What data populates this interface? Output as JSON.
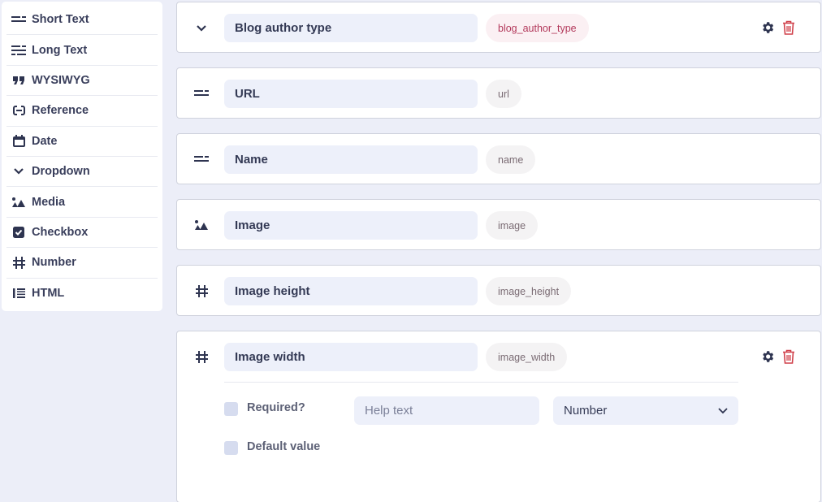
{
  "sidebar": {
    "items": [
      {
        "label": "Short Text",
        "icon": "short-text-icon"
      },
      {
        "label": "Long Text",
        "icon": "long-text-icon"
      },
      {
        "label": "WYSIWYG",
        "icon": "quote-icon"
      },
      {
        "label": "Reference",
        "icon": "link-icon"
      },
      {
        "label": "Date",
        "icon": "calendar-icon"
      },
      {
        "label": "Dropdown",
        "icon": "chevron-down-icon"
      },
      {
        "label": "Media",
        "icon": "image-icon"
      },
      {
        "label": "Checkbox",
        "icon": "checkbox-icon"
      },
      {
        "label": "Number",
        "icon": "hash-icon"
      },
      {
        "label": "HTML",
        "icon": "list-icon"
      }
    ]
  },
  "fields": [
    {
      "name": "Blog author type",
      "key": "blog_author_type",
      "icon": "chevron-down-icon",
      "key_highlight": true,
      "actions": true
    },
    {
      "name": "URL",
      "key": "url",
      "icon": "short-text-icon"
    },
    {
      "name": "Name",
      "key": "name",
      "icon": "short-text-icon"
    },
    {
      "name": "Image",
      "key": "image",
      "icon": "image-icon"
    },
    {
      "name": "Image height",
      "key": "image_height",
      "icon": "hash-icon"
    },
    {
      "name": "Image width",
      "key": "image_width",
      "icon": "hash-icon",
      "actions": true,
      "expanded": true
    }
  ],
  "expanded_options": {
    "required_label": "Required?",
    "required_checked": false,
    "default_value_label": "Default value",
    "default_value_checked": false,
    "help_text_placeholder": "Help text",
    "help_text_value": "",
    "type_select_value": "Number"
  },
  "colors": {
    "accent_key": "#b33a5c",
    "delete": "#d0414b",
    "icon": "#2e3450"
  }
}
